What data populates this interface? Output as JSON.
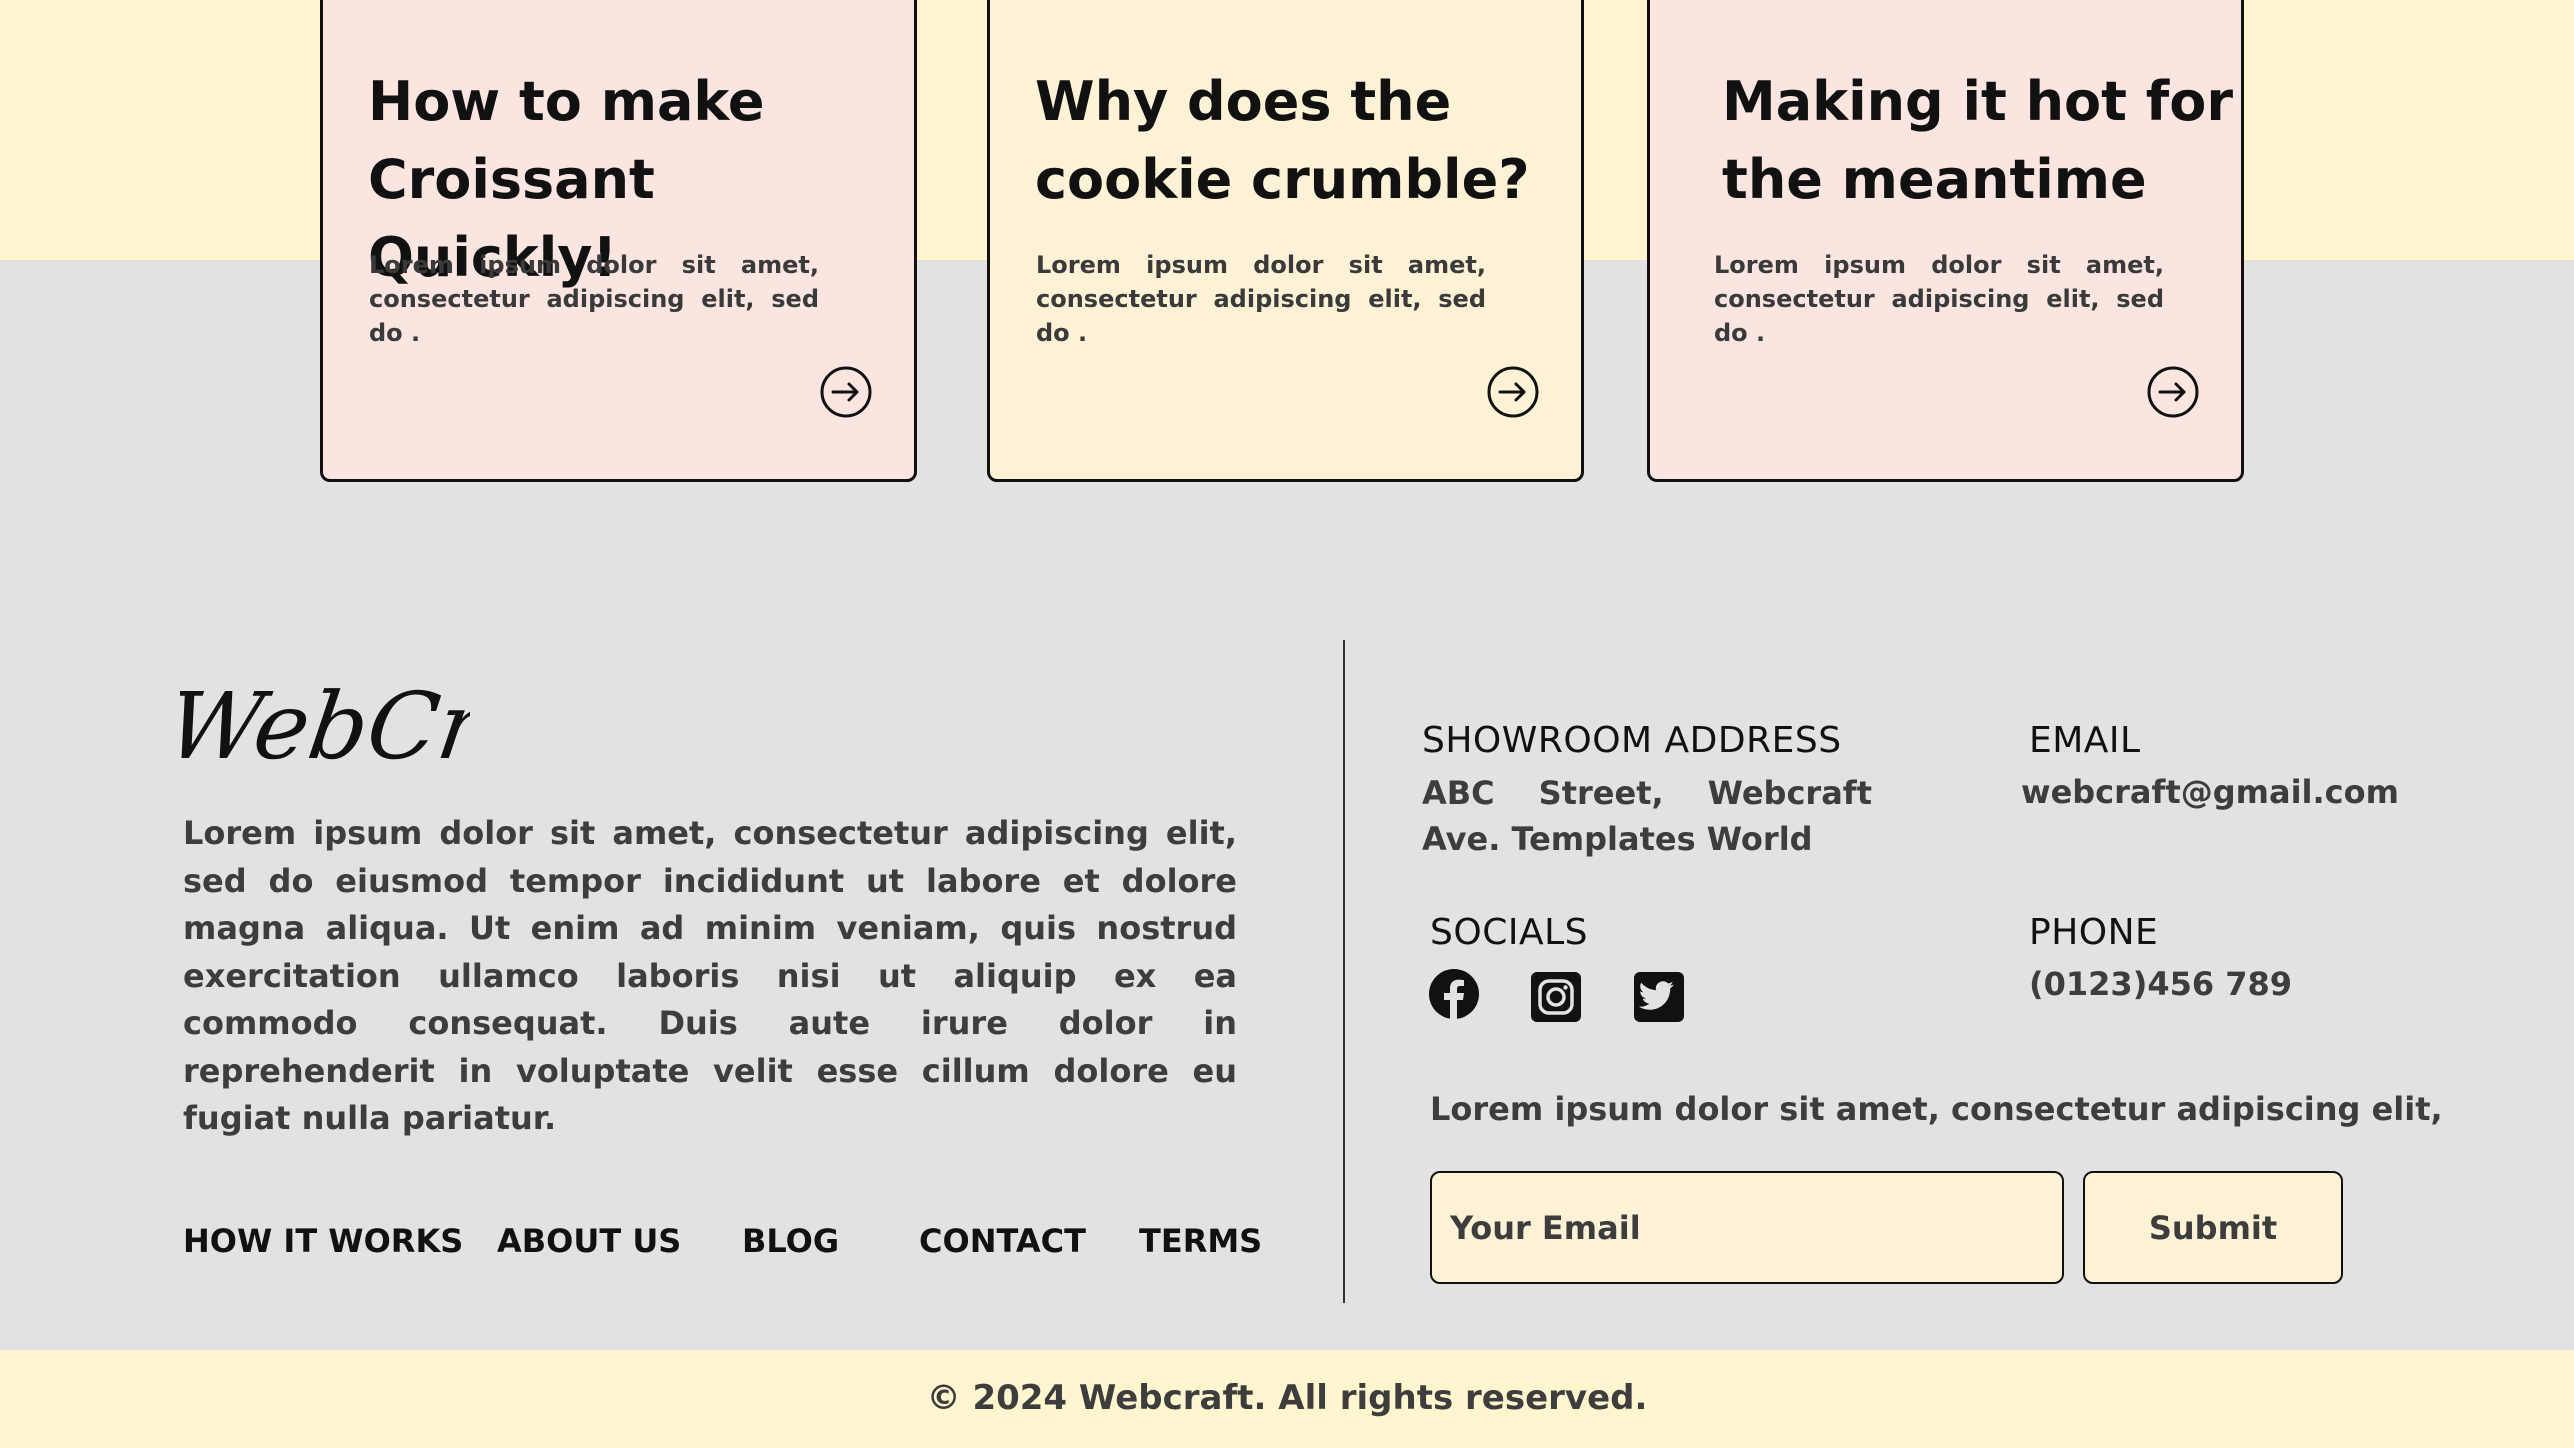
{
  "cards": [
    {
      "title_line1": "How to make",
      "title_line2": "Croissant Quickly!",
      "text": "Lorem ipsum dolor sit amet, consectetur adipiscing elit, sed do .",
      "icon": "arrow-right-circle-icon"
    },
    {
      "title_line1": "Why does the",
      "title_line2": "cookie crumble?",
      "text": "Lorem ipsum dolor sit amet, consectetur adipiscing elit, sed do .",
      "icon": "arrow-right-circle-icon"
    },
    {
      "title_line1": "Making it hot for",
      "title_line2": "the meantime",
      "text": "Lorem ipsum dolor sit amet, consectetur adipiscing elit, sed do .",
      "icon": "arrow-right-circle-icon"
    }
  ],
  "footer": {
    "logo_text": "WebCraft",
    "about": "Lorem ipsum dolor sit amet, consectetur adipiscing elit, sed do eiusmod tempor incididunt ut labore et dolore magna aliqua. Ut enim ad minim veniam, quis nostrud exercitation ullamco laboris nisi ut aliquip ex ea commodo consequat. Duis aute irure dolor in reprehenderit in voluptate velit esse cillum dolore eu fugiat nulla pariatur.",
    "nav": [
      "HOW IT WORKS",
      "ABOUT US",
      "BLOG",
      "CONTACT",
      "TERMS"
    ],
    "showroom_heading": "SHOWROOM ADDRESS",
    "showroom_address": "ABC Street, Webcraft Ave. Templates World",
    "email_heading": "EMAIL",
    "email": "webcraft@gmail.com",
    "socials_heading": "SOCIALS",
    "socials": [
      "facebook-icon",
      "instagram-icon",
      "twitter-icon"
    ],
    "phone_heading": "PHONE",
    "phone": "(0123)456 789",
    "newsletter_text": "Lorem ipsum dolor sit amet, consectetur adipiscing elit,",
    "email_placeholder": "Your Email",
    "submit_label": "Submit",
    "copyright": "© 2024 Webcraft. All rights reserved."
  },
  "colors": {
    "cream": "#fff6d0",
    "pink_card": "#fae5e1",
    "cream_card": "#fdf2d6",
    "gray_bg": "#e2e2e2"
  }
}
